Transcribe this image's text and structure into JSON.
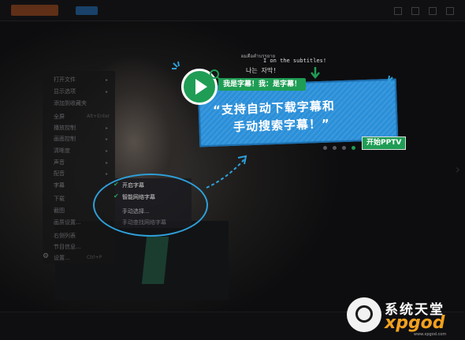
{
  "context_menu": {
    "items": [
      {
        "label": "打开文件",
        "has_submenu": true
      },
      {
        "label": "显示选项",
        "has_submenu": true
      },
      {
        "label": "添加到收藏夹",
        "has_submenu": false
      },
      {
        "label": "全屏",
        "shortcut": "Alt+Enter",
        "has_submenu": false
      },
      {
        "label": "播放控制",
        "has_submenu": true
      },
      {
        "label": "画面控制",
        "has_submenu": true
      },
      {
        "label": "清晰度",
        "has_submenu": true
      },
      {
        "label": "声音",
        "has_submenu": true
      },
      {
        "label": "配音",
        "has_submenu": true
      },
      {
        "label": "字幕",
        "has_submenu": true
      },
      {
        "label": "下载",
        "has_submenu": false
      },
      {
        "label": "截图",
        "has_submenu": false
      },
      {
        "label": "画质设置...",
        "has_submenu": false
      },
      {
        "label": "右侧列表",
        "has_submenu": false
      },
      {
        "label": "节目信息...",
        "has_submenu": false
      },
      {
        "label": "设置...",
        "shortcut": "Ctrl+P",
        "has_submenu": false
      }
    ]
  },
  "subtitle_submenu": {
    "items": [
      {
        "label": "开启字幕",
        "checked": true
      },
      {
        "label": "智能网络字幕",
        "checked": true
      },
      {
        "label": "手动选择...",
        "checked": false
      },
      {
        "label": "手动查找网络字幕",
        "checked": false
      }
    ]
  },
  "promo": {
    "speech_top": "ผมคือคำบรรยาย",
    "speech_en": "I on the subtitles!",
    "speech_kr": "나는 자막!",
    "tag": "我是字幕！我：是字幕！",
    "headline_line1": "“支持自动下载字幕和",
    "headline_line2": "手动搜索字幕！”",
    "cta": "开始PPTV",
    "dots": 4,
    "active_dot": 3
  },
  "watermark": {
    "cn": "系统天堂",
    "en": "xpgod",
    "url": "www.xpgod.com"
  },
  "colors": {
    "accent_green": "#1f9d55",
    "banner_blue": "#2a8fd9",
    "highlight_ring": "#2e9fd9",
    "watermark_orange": "#f2a01e"
  }
}
